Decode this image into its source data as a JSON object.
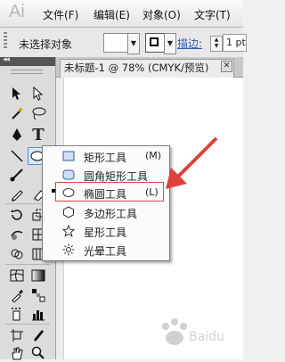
{
  "app": {
    "logo": "Ai"
  },
  "menubar": {
    "items": [
      "文件(F)",
      "编辑(E)",
      "对象(O)",
      "文字(T)"
    ]
  },
  "control_bar": {
    "selection_status": "未选择对象",
    "stroke_label": "描边:",
    "stroke_weight": "1 pt"
  },
  "document": {
    "tab_title": "未标题-1 @ 78% (CMYK/预览)",
    "close_glyph": "✕"
  },
  "flyout": {
    "items": [
      {
        "label": "矩形工具",
        "shortcut": "(M)",
        "icon": "rectangle-icon"
      },
      {
        "label": "圆角矩形工具",
        "shortcut": "",
        "icon": "rounded-rectangle-icon"
      },
      {
        "label": "椭圆工具",
        "shortcut": "(L)",
        "icon": "ellipse-icon",
        "selected": true
      },
      {
        "label": "多边形工具",
        "shortcut": "",
        "icon": "polygon-icon"
      },
      {
        "label": "星形工具",
        "shortcut": "",
        "icon": "star-icon"
      },
      {
        "label": "光晕工具",
        "shortcut": "",
        "icon": "flare-icon"
      }
    ]
  },
  "annotation": {
    "arrow_color": "#e0413a",
    "highlight_color": "#e0413a"
  },
  "colors": {
    "accent_link": "#2b5fb4",
    "selection_blue": "#4a90d9"
  }
}
